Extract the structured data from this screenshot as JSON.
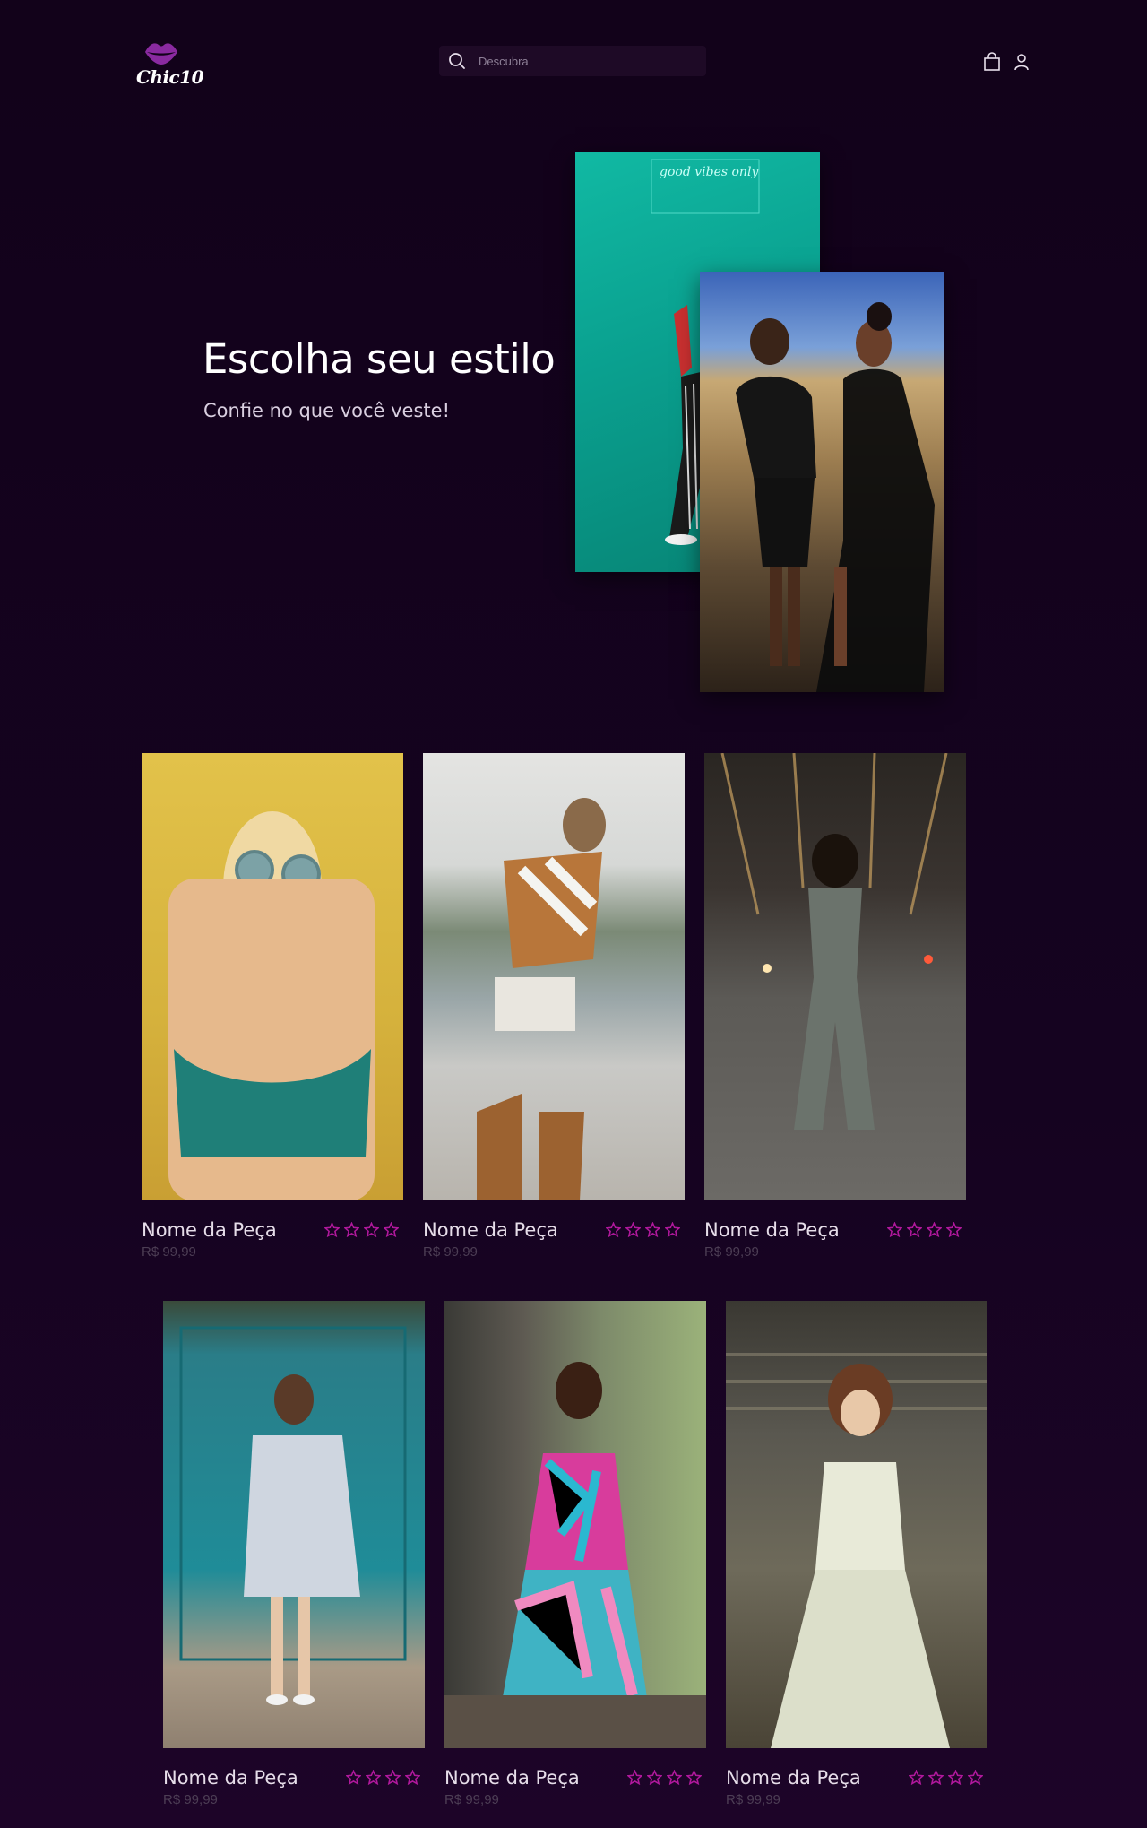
{
  "header": {
    "logo_text": "Chic10",
    "search_placeholder": "Descubra"
  },
  "hero": {
    "title": "Escolha seu estilo",
    "subtitle": "Confie no que você veste!",
    "neon_sign": "good vibes only"
  },
  "products_row_1": [
    {
      "name": "Nome da Peça",
      "price": "R$ 99,99",
      "rating": 4
    },
    {
      "name": "Nome da Peça",
      "price": "R$ 99,99",
      "rating": 4
    },
    {
      "name": "Nome da Peça",
      "price": "R$ 99,99",
      "rating": 4
    }
  ],
  "products_row_2": [
    {
      "name": "Nome da Peça",
      "price": "R$ 99,99",
      "rating": 4
    },
    {
      "name": "Nome da Peça",
      "price": "R$ 99,99",
      "rating": 4
    },
    {
      "name": "Nome da Peça",
      "price": "R$ 99,99",
      "rating": 4
    }
  ],
  "colors": {
    "background": "#12021a",
    "accent_star": "#b0189c",
    "logo": "#8a2aa0"
  },
  "icons": [
    "lips-logo-icon",
    "search-icon",
    "shopping-bag-icon",
    "user-icon",
    "star-icon"
  ]
}
